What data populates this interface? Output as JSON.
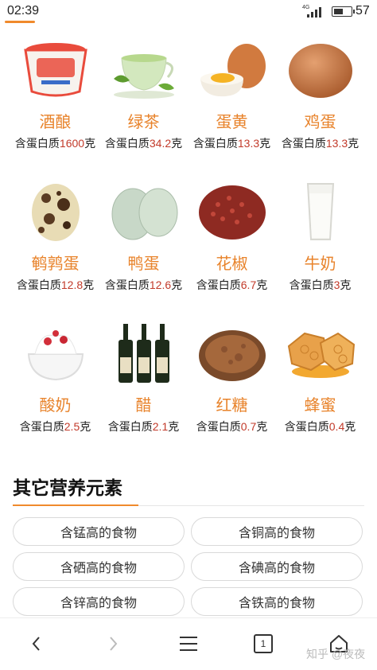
{
  "status_bar": {
    "time": "02:39",
    "network": "4G",
    "battery": "57",
    "battery_level": 0.57
  },
  "foods": [
    {
      "name": "酒酿",
      "prefix": "含蛋白质",
      "value": "1600",
      "unit": "克",
      "icon": "rice-wine-cup-image"
    },
    {
      "name": "绿茶",
      "prefix": "含蛋白质",
      "value": "34.2",
      "unit": "克",
      "icon": "green-tea-cup-image"
    },
    {
      "name": "蛋黄",
      "prefix": "含蛋白质",
      "value": "13.3",
      "unit": "克",
      "icon": "egg-yolk-image"
    },
    {
      "name": "鸡蛋",
      "prefix": "含蛋白质",
      "value": "13.3",
      "unit": "克",
      "icon": "chicken-egg-image"
    },
    {
      "name": "鹌鹑蛋",
      "prefix": "含蛋白质",
      "value": "12.8",
      "unit": "克",
      "icon": "quail-egg-image"
    },
    {
      "name": "鸭蛋",
      "prefix": "含蛋白质",
      "value": "12.6",
      "unit": "克",
      "icon": "duck-egg-image"
    },
    {
      "name": "花椒",
      "prefix": "含蛋白质",
      "value": "6.7",
      "unit": "克",
      "icon": "sichuan-pepper-image"
    },
    {
      "name": "牛奶",
      "prefix": "含蛋白质",
      "value": "3",
      "unit": "克",
      "icon": "milk-glass-image"
    },
    {
      "name": "酸奶",
      "prefix": "含蛋白质",
      "value": "2.5",
      "unit": "克",
      "icon": "yogurt-image"
    },
    {
      "name": "醋",
      "prefix": "含蛋白质",
      "value": "2.1",
      "unit": "克",
      "icon": "vinegar-bottles-image"
    },
    {
      "name": "红糖",
      "prefix": "含蛋白质",
      "value": "0.7",
      "unit": "克",
      "icon": "brown-sugar-image"
    },
    {
      "name": "蜂蜜",
      "prefix": "含蛋白质",
      "value": "0.4",
      "unit": "克",
      "icon": "honeycomb-image"
    }
  ],
  "section": {
    "title": "其它营养元素"
  },
  "nutrients": [
    "含锰高的食物",
    "含铜高的食物",
    "含硒高的食物",
    "含碘高的食物",
    "含锌高的食物",
    "含铁高的食物"
  ],
  "bottom_nav": {
    "tab_count": "1",
    "watermark": "知乎 @夜夜"
  },
  "colors": {
    "accent": "#f08a2c",
    "food_name": "#e8832b",
    "value": "#c23a2a"
  }
}
